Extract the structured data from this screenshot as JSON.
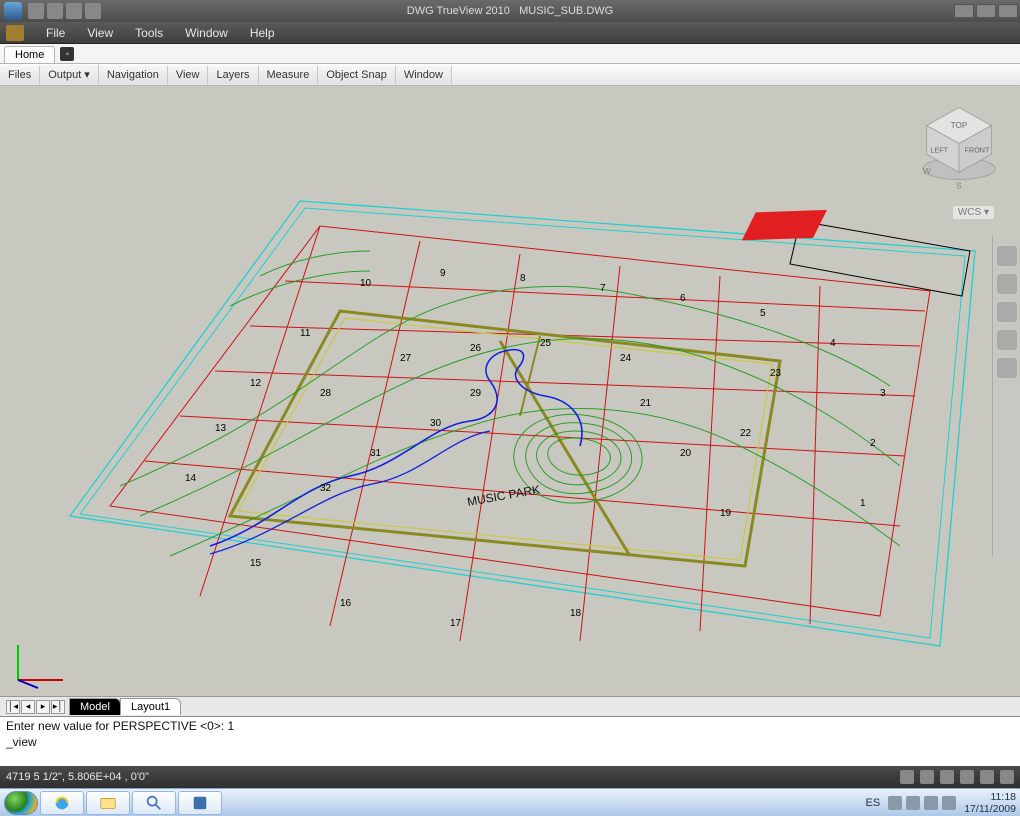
{
  "title": {
    "app": "DWG TrueView 2010",
    "file": "MUSIC_SUB.DWG"
  },
  "menu": {
    "file": "File",
    "view": "View",
    "tools": "Tools",
    "window": "Window",
    "help": "Help"
  },
  "tabs": {
    "home": "Home"
  },
  "ribbon": {
    "files": "Files",
    "output": "Output ▾",
    "navigation": "Navigation",
    "view": "View",
    "layers": "Layers",
    "measure": "Measure",
    "osnap": "Object Snap",
    "window": "Window"
  },
  "viewcube": {
    "top": "TOP",
    "left": "LEFT",
    "front": "FRONT",
    "w": "W",
    "s": "S"
  },
  "wcs": "WCS ▾",
  "drawing": {
    "park_label": "MUSIC PARK",
    "lot_numbers": [
      "1",
      "2",
      "3",
      "4",
      "5",
      "6",
      "7",
      "8",
      "9",
      "10",
      "11",
      "12",
      "13",
      "14",
      "15",
      "16",
      "17",
      "18",
      "19",
      "20",
      "21",
      "22",
      "23",
      "24",
      "25",
      "26",
      "27",
      "28",
      "29",
      "30",
      "31",
      "32"
    ],
    "title_block": "MUSIC_SUB"
  },
  "doc_tabs": {
    "model": "Model",
    "layout": "Layout1"
  },
  "command": {
    "line1": "Enter new value for PERSPECTIVE <0>: 1",
    "line2": "_view",
    "prompt": ""
  },
  "status": {
    "coords": "4719 5 1/2\", 5.806E+04 , 0'0\""
  },
  "systray": {
    "lang": "ES",
    "time": "11:18",
    "date": "17/11/2009"
  }
}
